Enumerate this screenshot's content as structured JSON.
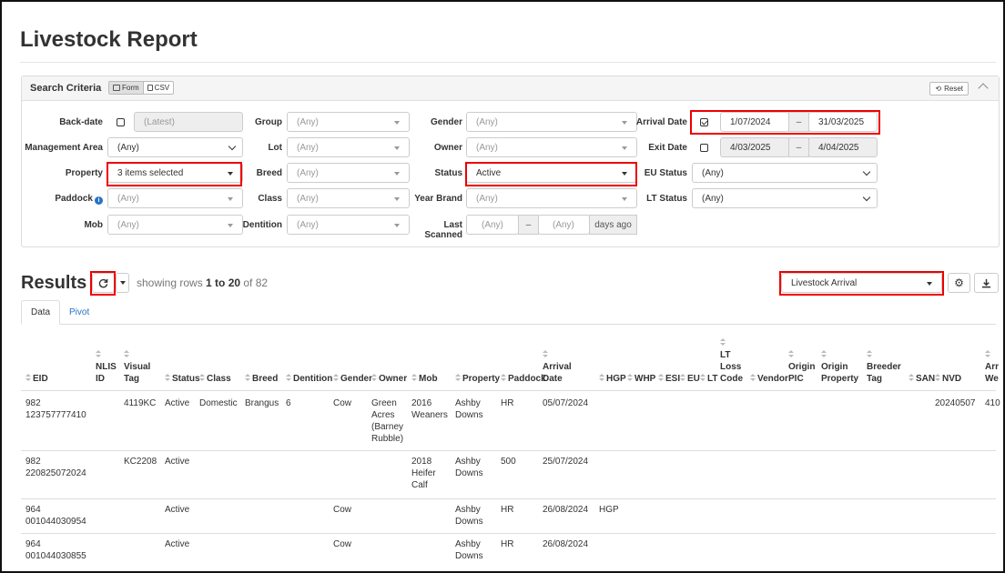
{
  "page": {
    "title": "Livestock Report"
  },
  "search": {
    "title": "Search Criteria",
    "mode_form": "Form",
    "mode_csv": "CSV",
    "reset": "Reset",
    "labels": {
      "backdate": "Back-date",
      "management_area": "Management Area",
      "property": "Property",
      "paddock": "Paddock",
      "mob": "Mob",
      "group": "Group",
      "lot": "Lot",
      "breed": "Breed",
      "class": "Class",
      "dentition": "Dentition",
      "gender": "Gender",
      "owner": "Owner",
      "status": "Status",
      "year_brand": "Year Brand",
      "last_scanned": "Last Scanned",
      "arrival_date": "Arrival Date",
      "exit_date": "Exit Date",
      "eu_status": "EU Status",
      "lt_status": "LT Status"
    },
    "values": {
      "backdate": "(Latest)",
      "management_area": "(Any)",
      "property": "3 items selected",
      "paddock": "(Any)",
      "mob": "(Any)",
      "group": "(Any)",
      "lot": "(Any)",
      "breed": "(Any)",
      "class": "(Any)",
      "dentition": "(Any)",
      "gender": "(Any)",
      "owner": "(Any)",
      "status": "Active",
      "year_brand": "(Any)",
      "last_scanned_from": "(Any)",
      "last_scanned_to": "(Any)",
      "last_scanned_suffix": "days ago",
      "arrival_from": "1/07/2024",
      "arrival_to": "31/03/2025",
      "exit_from": "4/03/2025",
      "exit_to": "4/04/2025",
      "eu_status": "(Any)",
      "lt_status": "(Any)",
      "range_sep": "–"
    }
  },
  "results": {
    "title": "Results",
    "showing_prefix": "showing rows ",
    "range": "1 to 20",
    "of_text": " of ",
    "total": "82",
    "report_select": "Livestock Arrival",
    "tabs": [
      "Data",
      "Pivot"
    ]
  },
  "table": {
    "headers": {
      "eid": "EID",
      "nlis": [
        "NLIS",
        "ID"
      ],
      "visual": [
        "Visual",
        "Tag"
      ],
      "status": "Status",
      "class": "Class",
      "breed": "Breed",
      "dentition": "Dentition",
      "gender": "Gender",
      "owner": "Owner",
      "mob": "Mob",
      "property": "Property",
      "paddock": "Paddock",
      "arrival": [
        "Arrival",
        "Date"
      ],
      "hgp": "HGP",
      "whp": "WHP",
      "esi": "ESI",
      "eu": "EU",
      "lt": "LT",
      "ltloss": [
        "LT",
        "Loss",
        "Code"
      ],
      "vendor": "Vendor",
      "opic": [
        "Origin",
        "PIC"
      ],
      "oprop": [
        "Origin",
        "Property"
      ],
      "btag": [
        "Breeder",
        "Tag"
      ],
      "san": "SAN",
      "nvd": "NVD",
      "arr_w": [
        "Arr",
        "We"
      ]
    },
    "rows": [
      {
        "eid": [
          "982",
          "123757777410"
        ],
        "visual": "4119KC",
        "status": "Active",
        "class": "Domestic",
        "breed": "Brangus",
        "dentition": "6",
        "gender": "Cow",
        "owner": [
          "Green",
          "Acres",
          "(Barney",
          "Rubble)"
        ],
        "mob": [
          "2016",
          "Weaners"
        ],
        "property": [
          "Ashby",
          "Downs"
        ],
        "paddock": "HR",
        "arrival": "05/07/2024",
        "hgp": "",
        "nvd": "20240507",
        "arr_w": "410"
      },
      {
        "eid": [
          "982",
          "220825072024"
        ],
        "visual": "KC2208",
        "status": "Active",
        "class": "",
        "breed": "",
        "dentition": "",
        "gender": "",
        "owner": [],
        "mob": [
          "2018",
          "Heifer",
          "Calf"
        ],
        "property": [
          "Ashby",
          "Downs"
        ],
        "paddock": "500",
        "arrival": "25/07/2024",
        "hgp": "",
        "nvd": "",
        "arr_w": ""
      },
      {
        "eid": [
          "964",
          "001044030954"
        ],
        "visual": "",
        "status": "Active",
        "class": "",
        "breed": "",
        "dentition": "",
        "gender": "Cow",
        "owner": [],
        "mob": [],
        "property": [
          "Ashby",
          "Downs"
        ],
        "paddock": "HR",
        "arrival": "26/08/2024",
        "hgp": "HGP",
        "nvd": "",
        "arr_w": ""
      },
      {
        "eid": [
          "964",
          "001044030855"
        ],
        "visual": "",
        "status": "Active",
        "class": "",
        "breed": "",
        "dentition": "",
        "gender": "Cow",
        "owner": [],
        "mob": [],
        "property": [
          "Ashby",
          "Downs"
        ],
        "paddock": "HR",
        "arrival": "26/08/2024",
        "hgp": "",
        "nvd": "",
        "arr_w": ""
      }
    ]
  }
}
